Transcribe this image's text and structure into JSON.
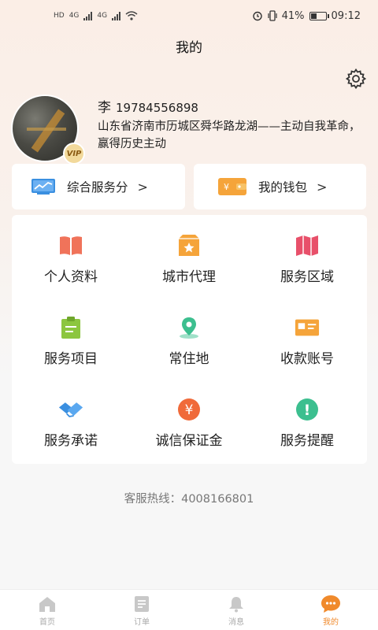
{
  "status_bar": {
    "left_labels": [
      "HD",
      "HD"
    ],
    "network": [
      "4G",
      "4G"
    ],
    "battery_percent": "41%",
    "battery_level": 0.41,
    "time": "09:12"
  },
  "header": {
    "title": "我的"
  },
  "profile": {
    "name": "李",
    "phone": "19784556898",
    "address": "山东省济南市历城区舜华路龙湖——主动自我革命，赢得历史主动",
    "badge": "VIP"
  },
  "quick_actions": [
    {
      "label": "综合服务分",
      "icon": "chart-card-icon"
    },
    {
      "label": "我的钱包",
      "icon": "wallet-icon",
      "icon_text": "¥"
    }
  ],
  "menu": [
    {
      "label": "个人资料",
      "icon": "book-icon",
      "color": "#f0735a"
    },
    {
      "label": "城市代理",
      "icon": "star-box-icon",
      "color": "#f5a43a"
    },
    {
      "label": "服务区域",
      "icon": "map-icon",
      "color": "#e8506a"
    },
    {
      "label": "服务项目",
      "icon": "clipboard-icon",
      "color": "#8cc63f"
    },
    {
      "label": "常住地",
      "icon": "location-pin-icon",
      "color": "#3cbf8f"
    },
    {
      "label": "收款账号",
      "icon": "card-icon",
      "color": "#f5a43a"
    },
    {
      "label": "服务承诺",
      "icon": "handshake-icon",
      "color": "#3a8fe0"
    },
    {
      "label": "诚信保证金",
      "icon": "yen-coin-icon",
      "color": "#f06a3a",
      "icon_text": "¥"
    },
    {
      "label": "服务提醒",
      "icon": "alert-icon",
      "color": "#3cbf8f",
      "icon_text": "!"
    }
  ],
  "hotline": "客服热线：4008166801",
  "tabs": [
    {
      "label": "首页",
      "icon": "home-icon"
    },
    {
      "label": "订单",
      "icon": "order-icon"
    },
    {
      "label": "消息",
      "icon": "bell-icon"
    },
    {
      "label": "我的",
      "icon": "chat-bubble-icon",
      "active": true
    }
  ]
}
